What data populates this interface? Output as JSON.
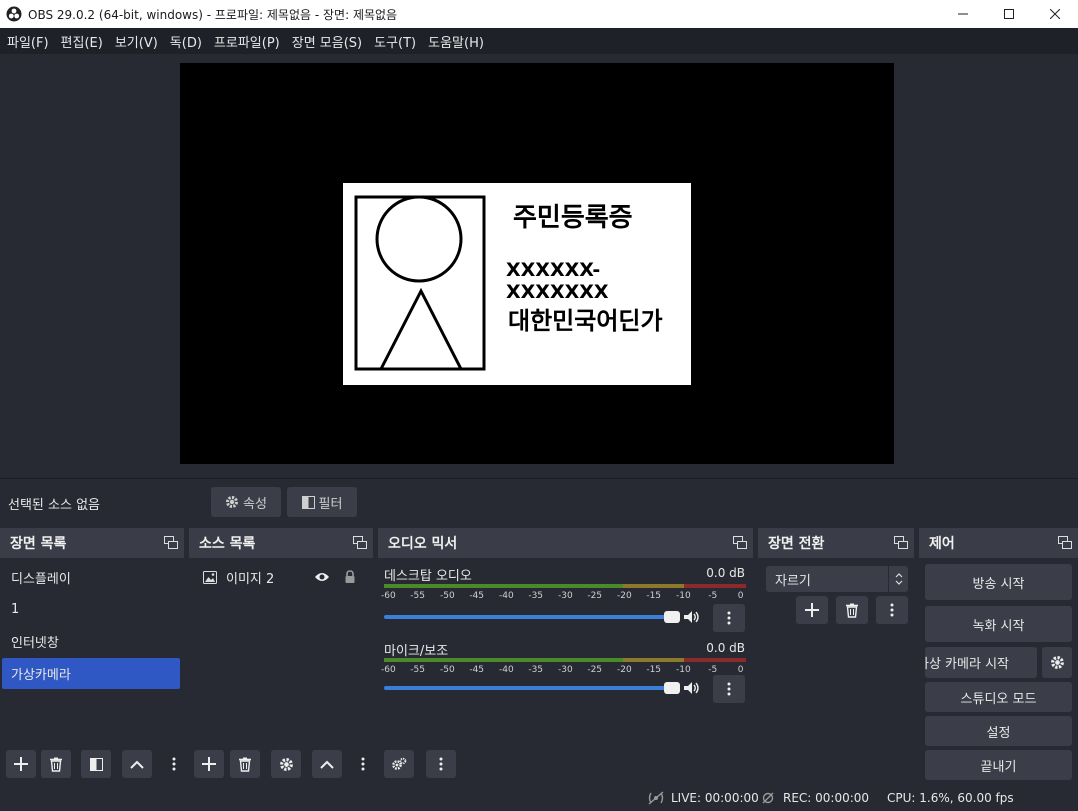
{
  "window": {
    "title": "OBS 29.0.2 (64-bit, windows) - 프로파일: 제목없음 - 장면: 제목없음"
  },
  "menu": [
    "파일(F)",
    "편집(E)",
    "보기(V)",
    "독(D)",
    "프로파일(P)",
    "장면 모음(S)",
    "도구(T)",
    "도움말(H)"
  ],
  "preview": {
    "card_title": "주민등록증",
    "card_number": "XXXXXX-XXXXXXX",
    "card_country": "대한민국어딘가"
  },
  "source_bar": {
    "no_selection": "선택된 소스 없음",
    "properties": "속성",
    "filters": "필터"
  },
  "scenes": {
    "title": "장면 목록",
    "items": [
      "디스플레이",
      "1",
      "인터넷창",
      "가상카메라"
    ],
    "active": "가상카메라"
  },
  "sources": {
    "title": "소스 목록",
    "items": [
      {
        "name": "이미지 2",
        "visible": true,
        "locked": true
      }
    ]
  },
  "mixer": {
    "title": "오디오 믹서",
    "ticks": [
      "-60",
      "-55",
      "-50",
      "-45",
      "-40",
      "-35",
      "-30",
      "-25",
      "-20",
      "-15",
      "-10",
      "-5",
      "0"
    ],
    "channels": [
      {
        "name": "데스크탑 오디오",
        "db": "0.0 dB"
      },
      {
        "name": "마이크/보조",
        "db": "0.0 dB"
      }
    ]
  },
  "transitions": {
    "title": "장면 전환",
    "selected": "자르기"
  },
  "controls": {
    "title": "제어",
    "stream": "방송 시작",
    "record": "녹화 시작",
    "virtual_cam": "가상 카메라 시작",
    "studio": "스튜디오 모드",
    "settings": "설정",
    "exit": "끝내기"
  },
  "status": {
    "live": "LIVE: 00:00:00",
    "rec": "REC: 00:00:00",
    "cpu": "CPU: 1.6%, 60.00 fps"
  },
  "colors": {
    "accent": "#2f58c4",
    "panel": "#272a33",
    "header": "#3a3d47",
    "button": "#3b3e48"
  }
}
